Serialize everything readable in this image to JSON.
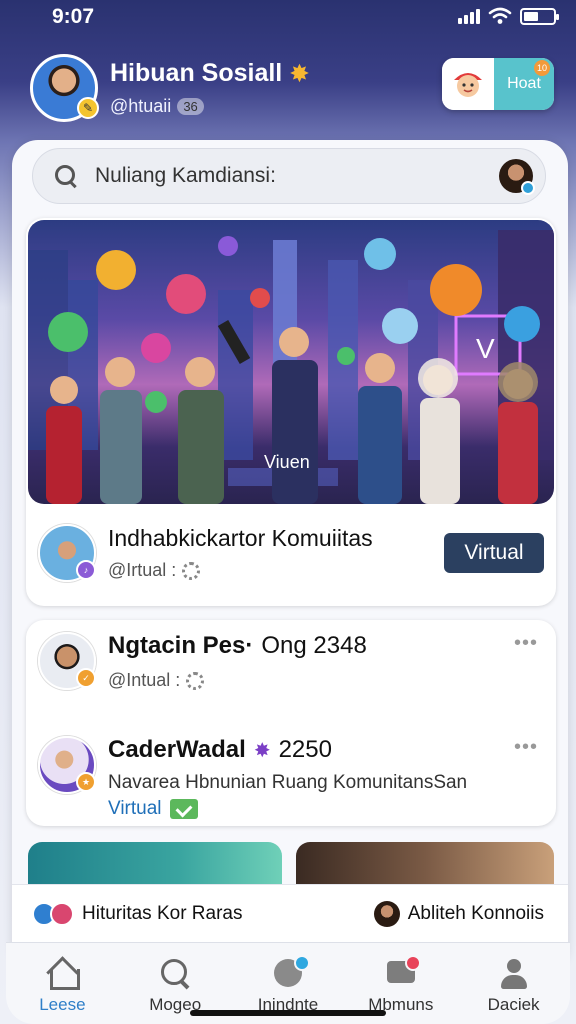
{
  "status": {
    "time": "9:07"
  },
  "profile": {
    "name": "Hibuan Sosiall",
    "handle": "@htuaii",
    "handle_count": "36"
  },
  "header_action": {
    "label": "Hoat",
    "badge": "10"
  },
  "search": {
    "placeholder": "Nuliang Kamdiansi:"
  },
  "feature": {
    "hero_tag": "Viuen",
    "title": "Indhabkickartor Komuiitas",
    "subtitle": "@Irtual :",
    "button_label": "Virtual"
  },
  "list": {
    "items": [
      {
        "title": "Ngtacin Pes·",
        "count": "Ong 2348",
        "subtitle": "@Intual :"
      },
      {
        "title": "CaderWadal",
        "count": "2250",
        "description": "Navarea Hbnunian Ruang KomunitansSan",
        "link": "Virtual"
      }
    ]
  },
  "activity": {
    "left_text": "Hituritas Kor Raras",
    "right_text": "Abliteh Konnoiis"
  },
  "tabs": [
    {
      "label": "Leese",
      "icon": "home-icon"
    },
    {
      "label": "Mogeo",
      "icon": "search-icon"
    },
    {
      "label": "Inindnte",
      "icon": "create-icon"
    },
    {
      "label": "Mbmuns",
      "icon": "messages-icon"
    },
    {
      "label": "Daciek",
      "icon": "profile-icon"
    }
  ],
  "colors": {
    "accent": "#2f7fc8",
    "button": "#2b4060",
    "header_action": "#58c3cc"
  }
}
